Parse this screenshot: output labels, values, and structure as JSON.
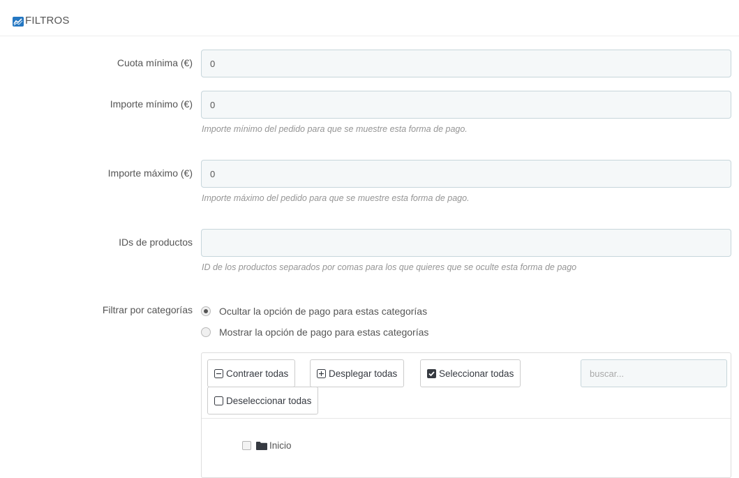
{
  "header": {
    "title": "FILTROS",
    "icon": "trend-chart-icon",
    "icon_color": "#2477c2"
  },
  "fields": {
    "cuota_minima": {
      "label": "Cuota mínima (€)",
      "value": "0"
    },
    "importe_minimo": {
      "label": "Importe mínimo (€)",
      "value": "0",
      "help": "Importe mínimo del pedido para que se muestre esta forma de pago."
    },
    "importe_maximo": {
      "label": "Importe máximo (€)",
      "value": "0",
      "help": "Importe máximo del pedido para que se muestre esta forma de pago."
    },
    "ids_productos": {
      "label": "IDs de productos",
      "value": "",
      "help": "ID de los productos separados por comas para los que quieres que se oculte esta forma de pago"
    }
  },
  "category_filter": {
    "label": "Filtrar por categorías",
    "options": [
      {
        "label": "Ocultar la opción de pago para estas categorías",
        "selected": true
      },
      {
        "label": "Mostrar la opción de pago para estas categorías",
        "selected": false
      }
    ]
  },
  "tree": {
    "buttons": {
      "collapse": "Contraer todas",
      "expand": "Desplegar todas",
      "select_all": "Seleccionar todas",
      "deselect_all": "Deseleccionar todas"
    },
    "search_placeholder": "buscar...",
    "root_label": "Inicio"
  }
}
